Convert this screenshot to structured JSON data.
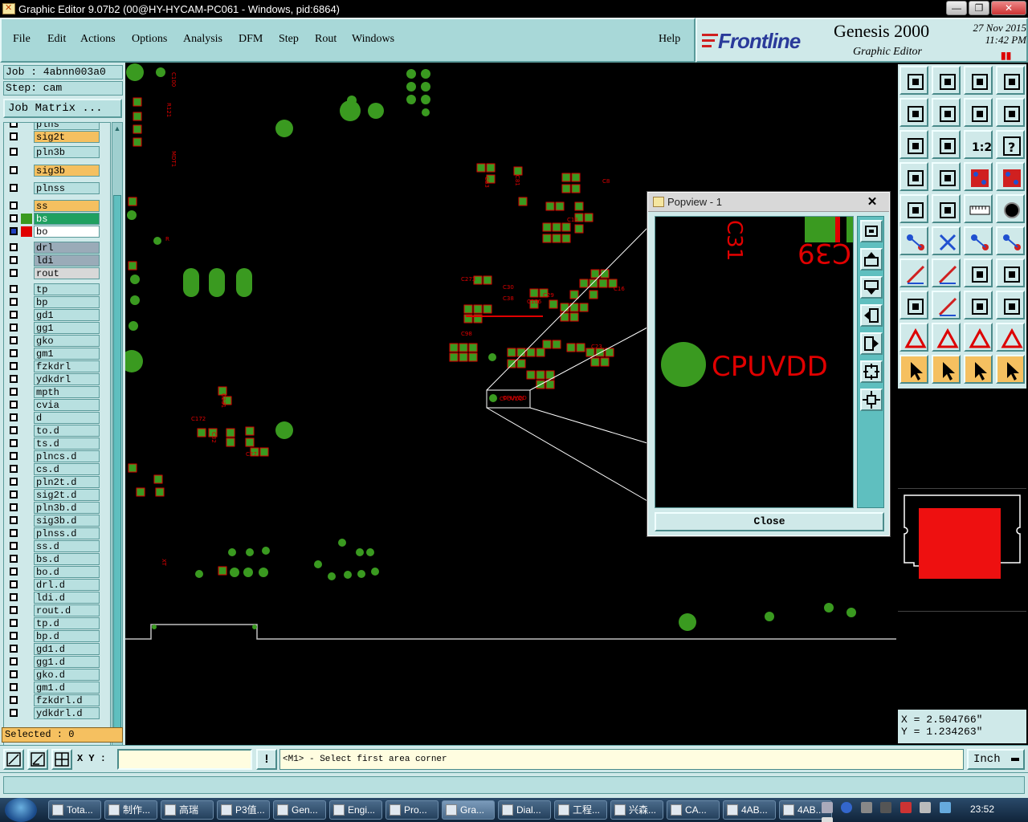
{
  "window": {
    "title": "Graphic Editor 9.07b2 (00@HY-HYCAM-PC061 - Windows, pid:6864)",
    "minimize": "—",
    "maximize": "❐",
    "close": "✕"
  },
  "menu": {
    "items": [
      "File",
      "Edit",
      "Actions",
      "Options",
      "Analysis",
      "DFM",
      "Step",
      "Rout",
      "Windows"
    ],
    "help": "Help"
  },
  "brand": {
    "logo": "Frontline",
    "product": "Genesis 2000",
    "subtitle": "Graphic Editor",
    "date": "27 Nov 2015",
    "time": "11:42 PM"
  },
  "left": {
    "job": "Job  : 4abnn003a0",
    "step": "Step: cam",
    "job_matrix": "Job Matrix ...",
    "selected": "Selected : 0",
    "layers": [
      {
        "name": "plns",
        "color": "#b8e0e0",
        "swatch": ""
      },
      {
        "name": "sig2t",
        "color": "#f5c060",
        "swatch": ""
      },
      {
        "name": "pln3b",
        "color": "#b8e0e0",
        "swatch": ""
      },
      {
        "name": "sig3b",
        "color": "#f5c060",
        "swatch": ""
      },
      {
        "name": "plnss",
        "color": "#b8e0e0",
        "swatch": ""
      },
      {
        "name": "ss",
        "color": "#f5c060",
        "swatch": ""
      },
      {
        "name": "bs",
        "color": "#20a060",
        "swatch": "#3a9a20"
      },
      {
        "name": "bo",
        "color": "#ffffff",
        "swatch": "#e00000"
      },
      {
        "name": "drl",
        "color": "#9aabb8",
        "swatch": ""
      },
      {
        "name": "ldi",
        "color": "#9aabb8",
        "swatch": ""
      },
      {
        "name": "rout",
        "color": "#d8d8d8",
        "swatch": ""
      },
      {
        "name": "tp",
        "color": "#b8e0e0",
        "swatch": ""
      },
      {
        "name": "bp",
        "color": "#b8e0e0",
        "swatch": ""
      },
      {
        "name": "gd1",
        "color": "#b8e0e0",
        "swatch": ""
      },
      {
        "name": "gg1",
        "color": "#b8e0e0",
        "swatch": ""
      },
      {
        "name": "gko",
        "color": "#b8e0e0",
        "swatch": ""
      },
      {
        "name": "gm1",
        "color": "#b8e0e0",
        "swatch": ""
      },
      {
        "name": "fzkdrl",
        "color": "#b8e0e0",
        "swatch": ""
      },
      {
        "name": "ydkdrl",
        "color": "#b8e0e0",
        "swatch": ""
      },
      {
        "name": "mpth",
        "color": "#b8e0e0",
        "swatch": ""
      },
      {
        "name": "cvia",
        "color": "#b8e0e0",
        "swatch": ""
      },
      {
        "name": "d",
        "color": "#b8e0e0",
        "swatch": ""
      },
      {
        "name": "to.d",
        "color": "#b8e0e0",
        "swatch": ""
      },
      {
        "name": "ts.d",
        "color": "#b8e0e0",
        "swatch": ""
      },
      {
        "name": "plncs.d",
        "color": "#b8e0e0",
        "swatch": ""
      },
      {
        "name": "cs.d",
        "color": "#b8e0e0",
        "swatch": ""
      },
      {
        "name": "pln2t.d",
        "color": "#b8e0e0",
        "swatch": ""
      },
      {
        "name": "sig2t.d",
        "color": "#b8e0e0",
        "swatch": ""
      },
      {
        "name": "pln3b.d",
        "color": "#b8e0e0",
        "swatch": ""
      },
      {
        "name": "sig3b.d",
        "color": "#b8e0e0",
        "swatch": ""
      },
      {
        "name": "plnss.d",
        "color": "#b8e0e0",
        "swatch": ""
      },
      {
        "name": "ss.d",
        "color": "#b8e0e0",
        "swatch": ""
      },
      {
        "name": "bs.d",
        "color": "#b8e0e0",
        "swatch": ""
      },
      {
        "name": "bo.d",
        "color": "#b8e0e0",
        "swatch": ""
      },
      {
        "name": "drl.d",
        "color": "#b8e0e0",
        "swatch": ""
      },
      {
        "name": "ldi.d",
        "color": "#b8e0e0",
        "swatch": ""
      },
      {
        "name": "rout.d",
        "color": "#b8e0e0",
        "swatch": ""
      },
      {
        "name": "tp.d",
        "color": "#b8e0e0",
        "swatch": ""
      },
      {
        "name": "bp.d",
        "color": "#b8e0e0",
        "swatch": ""
      },
      {
        "name": "gd1.d",
        "color": "#b8e0e0",
        "swatch": ""
      },
      {
        "name": "gg1.d",
        "color": "#b8e0e0",
        "swatch": ""
      },
      {
        "name": "gko.d",
        "color": "#b8e0e0",
        "swatch": ""
      },
      {
        "name": "gm1.d",
        "color": "#b8e0e0",
        "swatch": ""
      },
      {
        "name": "fzkdrl.d",
        "color": "#b8e0e0",
        "swatch": ""
      },
      {
        "name": "ydkdrl.d",
        "color": "#b8e0e0",
        "swatch": ""
      }
    ]
  },
  "canvas": {
    "board_label": "CPUVDD",
    "colors": {
      "pad": "#3a9a20",
      "silk": "#e00000",
      "outline": "#c0c0c0"
    }
  },
  "popview": {
    "title": "Popview - 1",
    "label": "CPUVDD",
    "ref_top": "C39",
    "close": "Close"
  },
  "right": {
    "coord_x": "X = 2.504766\"",
    "coord_y": "Y = 1.234263\"",
    "zoom_ratio": "1:2",
    "help_glyph": "?"
  },
  "bottom": {
    "xy_label": "X Y :",
    "xy_value": "",
    "warn": "!",
    "status": "<M1> - Select first area corner",
    "unit": "Inch"
  },
  "taskbar": {
    "tasks": [
      "Tota...",
      "制作...",
      "高瑞",
      "P3值...",
      "Gen...",
      "Engi...",
      "Pro...",
      "Gra...",
      "Dial...",
      "工程...",
      "兴森...",
      "CA...",
      "4AB...",
      "4AB..."
    ],
    "clock": "23:52"
  }
}
